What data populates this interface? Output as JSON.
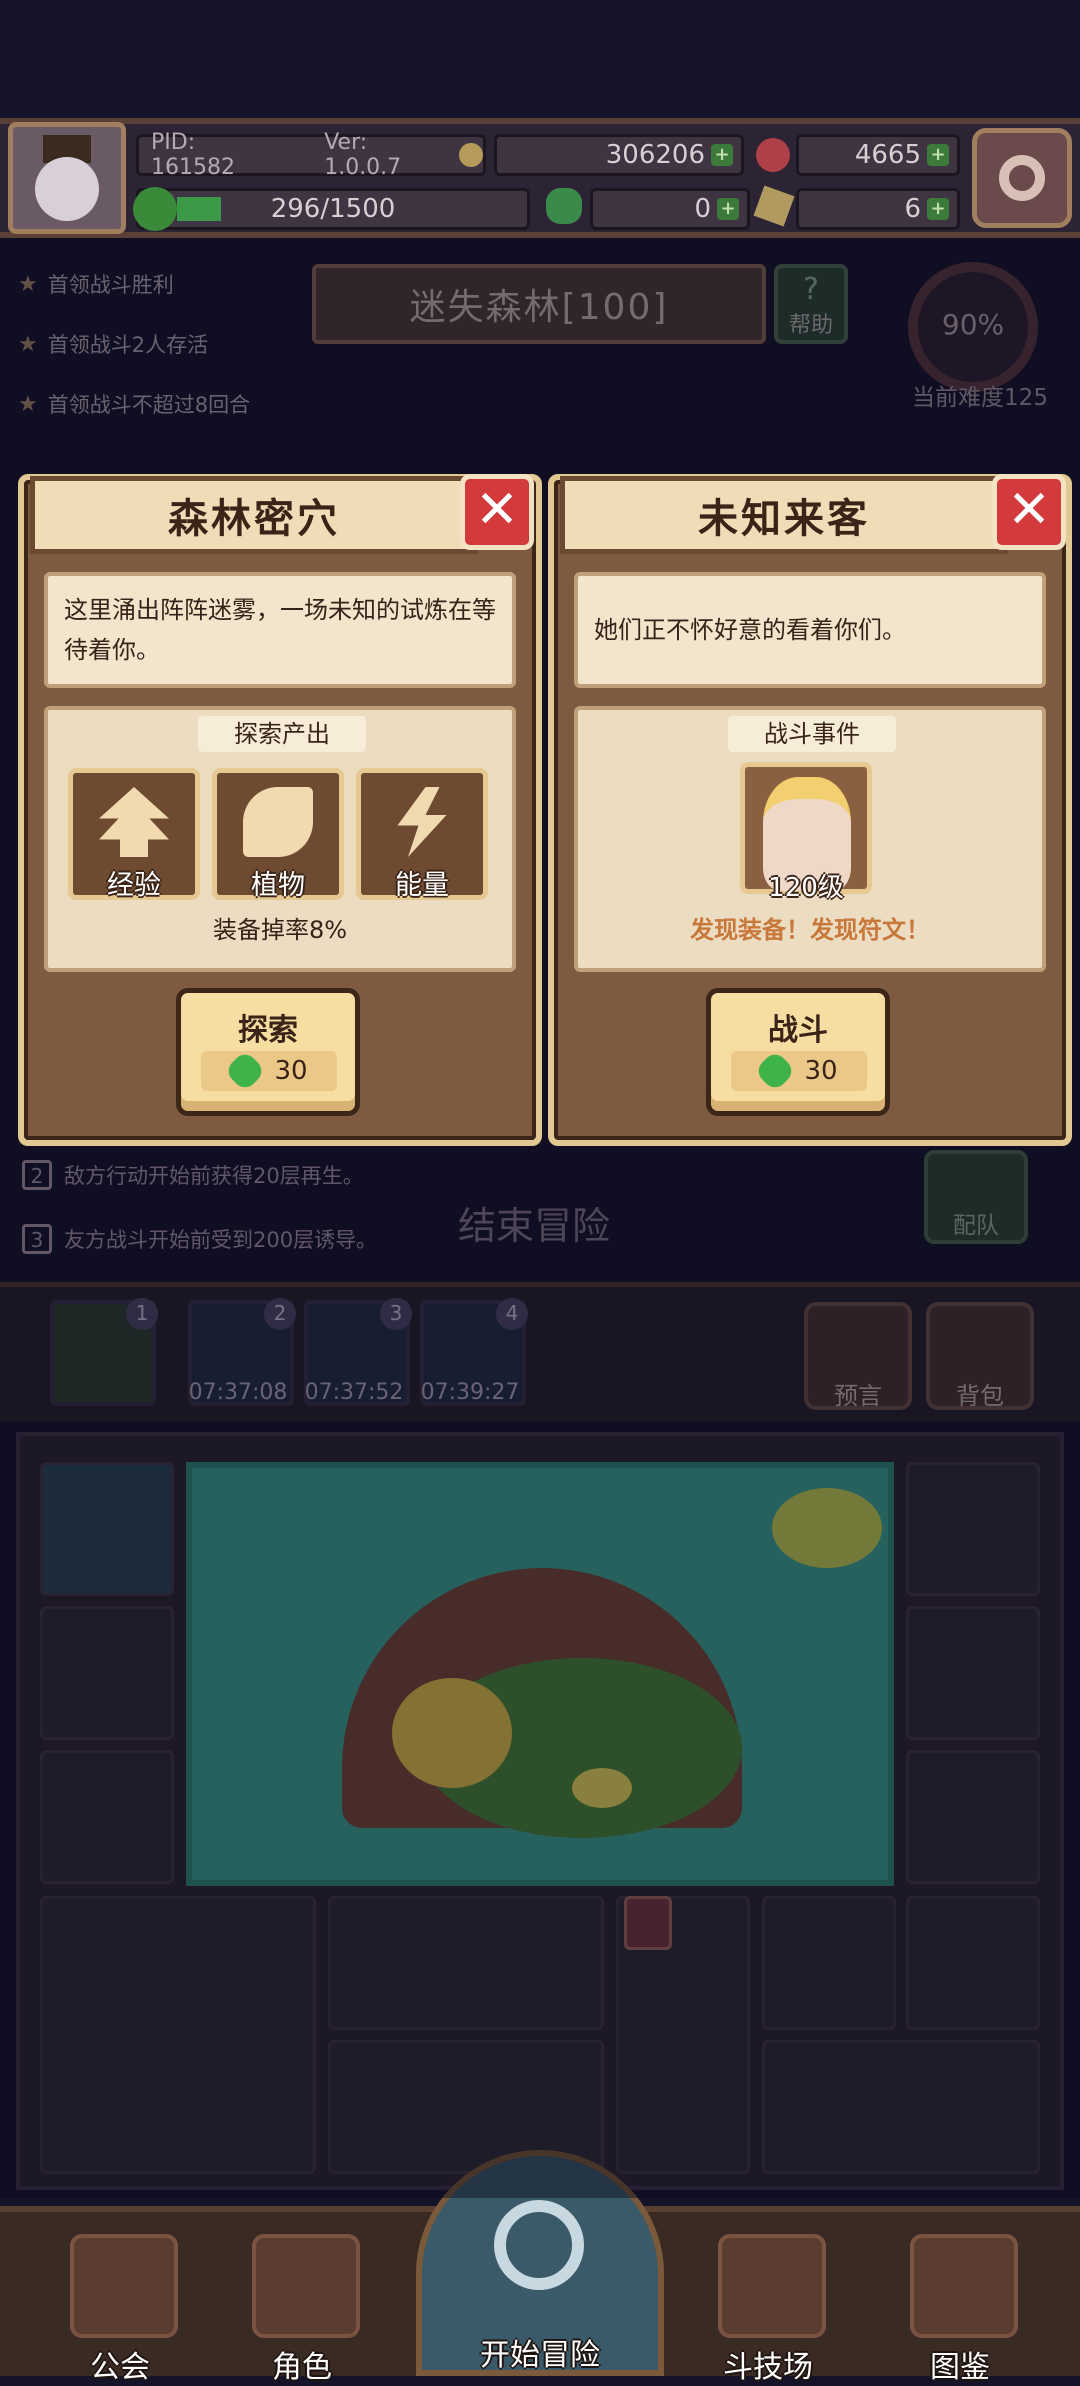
{
  "header": {
    "pid": "PID: 161582",
    "version": "Ver: 1.0.0.7",
    "gold": "306206",
    "gems": "4665",
    "stamina": "296/1500",
    "clover_count": "0",
    "key_count": "6"
  },
  "quests": [
    {
      "label": "首领战斗胜利"
    },
    {
      "label": "首领战斗2人存活"
    },
    {
      "label": "首领战斗不超过8回合"
    }
  ],
  "stage": {
    "title": "迷失森林[100]",
    "help_label": "帮助",
    "difficulty_pct": "90%",
    "difficulty_label": "当前难度125"
  },
  "rules": [
    {
      "num": "2",
      "text": "敌方行动开始前获得20层再生。"
    },
    {
      "num": "3",
      "text": "友方战斗开始前受到200层诱导。"
    }
  ],
  "end_adventure": "结束冒险",
  "team_label": "配队",
  "slots": [
    {
      "num": "1",
      "time": ""
    },
    {
      "num": "2",
      "time": "07:37:08"
    },
    {
      "num": "3",
      "time": "07:37:52"
    },
    {
      "num": "4",
      "time": "07:39:27"
    }
  ],
  "side_buttons": {
    "prophecy": "预言",
    "backpack": "背包"
  },
  "card_left": {
    "title": "森林密穴",
    "close_symbol": "✕",
    "description": "这里涌出阵阵迷雾，一场未知的试炼在等待着你。",
    "section_title": "探索产出",
    "rewards": [
      {
        "label": "经验",
        "icon": "arrow-up-icon"
      },
      {
        "label": "植物",
        "icon": "leaf-icon"
      },
      {
        "label": "能量",
        "icon": "lightning-icon"
      }
    ],
    "drop_rate": "装备掉率8%",
    "button_label": "探索",
    "cost": "30"
  },
  "card_right": {
    "title": "未知来客",
    "close_symbol": "✕",
    "description": "她们正不怀好意的看着你们。",
    "section_title": "战斗事件",
    "enemy_level": "120级",
    "find_text": "发现装备！发现符文！",
    "button_label": "战斗",
    "cost": "30"
  },
  "nav": {
    "guild": "公会",
    "character": "角色",
    "start": "开始冒险",
    "arena": "斗技场",
    "codex": "图鉴"
  },
  "colors": {
    "card_border": "#e2c892",
    "close_red": "#d23a3c",
    "gem_green": "#3fb34a",
    "find_orange": "#c8783a"
  }
}
